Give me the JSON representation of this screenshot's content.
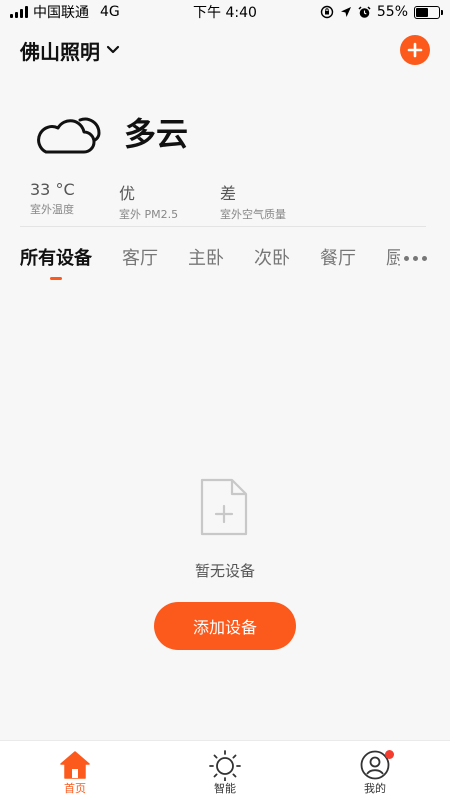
{
  "status_bar": {
    "carrier": "中国联通",
    "network": "4G",
    "time": "下午 4:40",
    "battery": "55%",
    "battery_level": 0.55
  },
  "header": {
    "location": "佛山照明"
  },
  "weather": {
    "condition": "多云",
    "icon": "cloud-icon",
    "stats": [
      {
        "value": "33 °C",
        "label": "室外温度"
      },
      {
        "value": "优",
        "label": "室外 PM2.5"
      },
      {
        "value": "差",
        "label": "室外空气质量"
      }
    ]
  },
  "tabs": [
    {
      "label": "所有设备",
      "active": true
    },
    {
      "label": "客厅",
      "active": false
    },
    {
      "label": "主卧",
      "active": false
    },
    {
      "label": "次卧",
      "active": false
    },
    {
      "label": "餐厅",
      "active": false
    },
    {
      "label": "厨房",
      "active": false
    }
  ],
  "empty_state": {
    "text": "暂无设备",
    "button_label": "添加设备"
  },
  "bottom_nav": [
    {
      "label": "首页",
      "icon": "home-icon",
      "active": true
    },
    {
      "label": "智能",
      "icon": "sun-icon",
      "active": false
    },
    {
      "label": "我的",
      "icon": "user-icon",
      "active": false,
      "badge": true
    }
  ],
  "colors": {
    "accent": "#fc5a1d",
    "badge": "#f43c2f"
  }
}
